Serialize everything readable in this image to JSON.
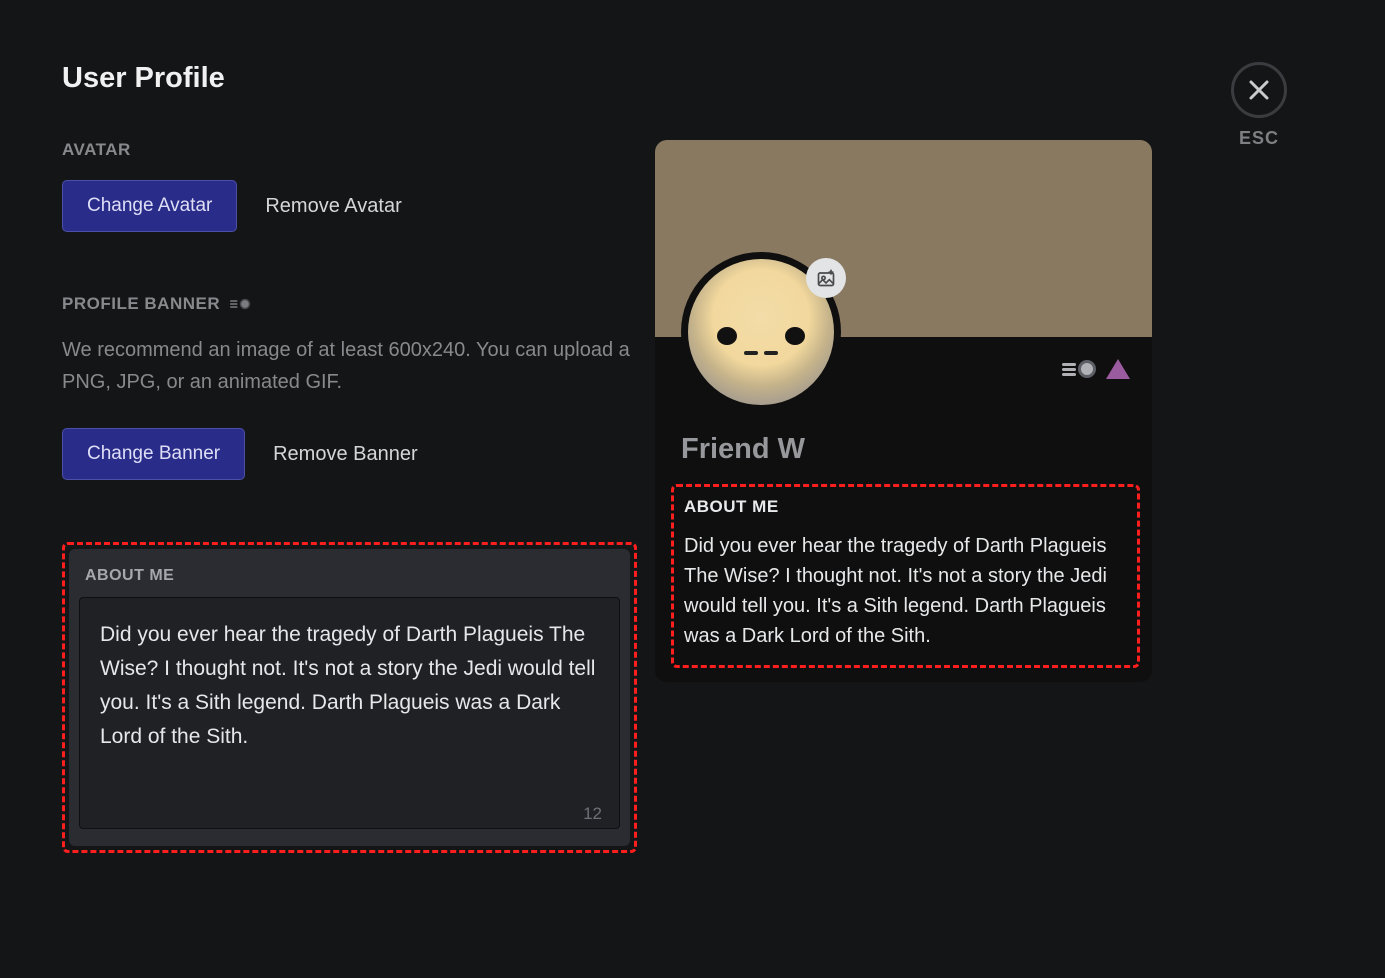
{
  "page": {
    "title": "User Profile"
  },
  "avatar": {
    "label": "AVATAR",
    "change": "Change Avatar",
    "remove": "Remove Avatar"
  },
  "banner": {
    "label": "PROFILE BANNER",
    "desc": "We recommend an image of at least 600x240. You can upload a PNG, JPG, or an animated GIF.",
    "change": "Change Banner",
    "remove": "Remove Banner"
  },
  "about": {
    "label": "ABOUT ME",
    "value": "Did you ever hear the tragedy of Darth Plagueis The Wise? I thought not. It's not a story the Jedi would tell you. It's a Sith legend. Darth Plagueis was a Dark Lord of the Sith.",
    "chars_remaining": "12"
  },
  "preview": {
    "display_name": "Friend W",
    "about_label": "ABOUT ME",
    "about_text": "Did you ever hear the tragedy of Darth Plagueis The Wise? I thought not. It's not a story the Jedi would tell you. It's a Sith legend. Darth Plagueis was a Dark Lord of the Sith."
  },
  "close": {
    "label": "ESC"
  }
}
